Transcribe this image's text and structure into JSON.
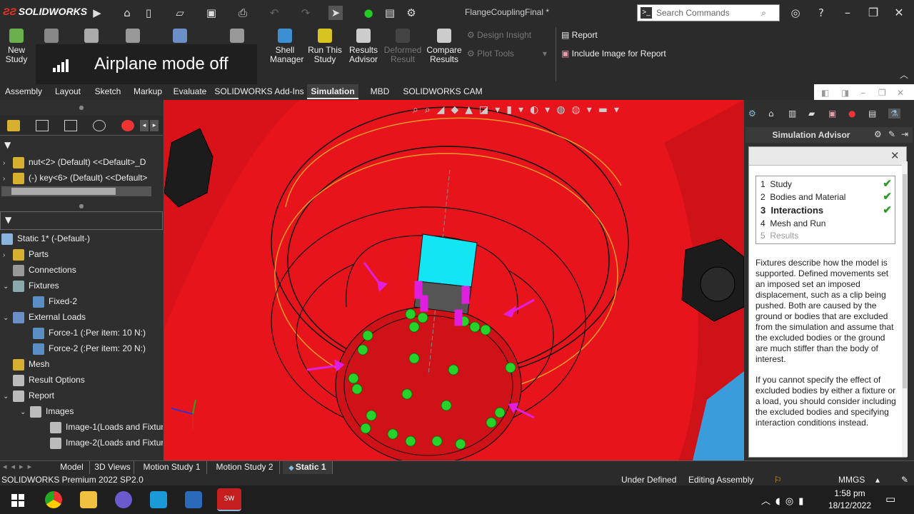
{
  "app": {
    "brand": "SOLIDWORKS",
    "doc_title": "FlangeCouplingFinal *"
  },
  "search": {
    "placeholder": "Search Commands"
  },
  "ribbon": {
    "new_study": "New Study",
    "shell_manager": "Shell Manager",
    "run_study": "Run This Study",
    "results_advisor": "Results Advisor",
    "deformed_result": "Deformed Result",
    "compare_results": "Compare Results",
    "design_insight": "Design Insight",
    "plot_tools": "Plot Tools",
    "report": "Report",
    "include_image": "Include Image for Report"
  },
  "notification": {
    "text": "Airplane mode off"
  },
  "tabs": [
    "Assembly",
    "Layout",
    "Sketch",
    "Markup",
    "Evaluate",
    "SOLIDWORKS Add-Ins",
    "Simulation",
    "MBD",
    "SOLIDWORKS CAM"
  ],
  "active_tab": "Simulation",
  "feature_tree": {
    "items": [
      "nut<2> (Default) <<Default>_D",
      "(-) key<6> (Default) <<Default>"
    ]
  },
  "sim_tree": {
    "root": "Static 1* (-Default-)",
    "items": [
      {
        "label": "Parts"
      },
      {
        "label": "Connections"
      },
      {
        "label": "Fixtures"
      },
      {
        "label": "Fixed-2"
      },
      {
        "label": "External Loads"
      },
      {
        "label": "Force-1 (:Per item: 10 N:)"
      },
      {
        "label": "Force-2 (:Per item: 20 N:)"
      },
      {
        "label": "Mesh"
      },
      {
        "label": "Result Options"
      },
      {
        "label": "Report"
      },
      {
        "label": "Images"
      },
      {
        "label": "Image-1(Loads and Fixtur"
      },
      {
        "label": "Image-2(Loads and Fixtur"
      }
    ]
  },
  "advisor": {
    "title": "Simulation Advisor",
    "steps": [
      {
        "num": "1",
        "label": "Study"
      },
      {
        "num": "2",
        "label": "Bodies and Material"
      },
      {
        "num": "3",
        "label": "Interactions"
      },
      {
        "num": "4",
        "label": "Mesh and Run"
      },
      {
        "num": "5",
        "label": "Results"
      }
    ],
    "checkmark": "✔",
    "para1": "Fixtures describe how the model is supported. Defined movements set an imposed set an imposed displacement, such as a clip being pushed. Both are caused by the ground or bodies that are excluded from the simulation and assume that the excluded bodies or the ground are much stiffer than the body of interest.",
    "para2": "If you cannot specify the effect of excluded bodies by either a fixture or a load, you should consider including the excluded bodies and specifying interaction conditions instead."
  },
  "bottom_tabs": [
    "Model",
    "3D Views",
    "Motion Study 1",
    "Motion Study 2",
    "Static 1"
  ],
  "active_bottom_tab": "Static 1",
  "status": {
    "product": "SOLIDWORKS Premium 2022 SP2.0",
    "defined": "Under Defined",
    "mode": "Editing Assembly",
    "units": "MMGS"
  },
  "clock": {
    "time": "1:58 pm",
    "date": "18/12/2022"
  },
  "colors": {
    "model_red": "#e8141b",
    "fixture_green": "#27d22a",
    "load_magenta": "#e01ee0",
    "cyan_block": "#13e6f2",
    "background": "#2b2b2b"
  }
}
